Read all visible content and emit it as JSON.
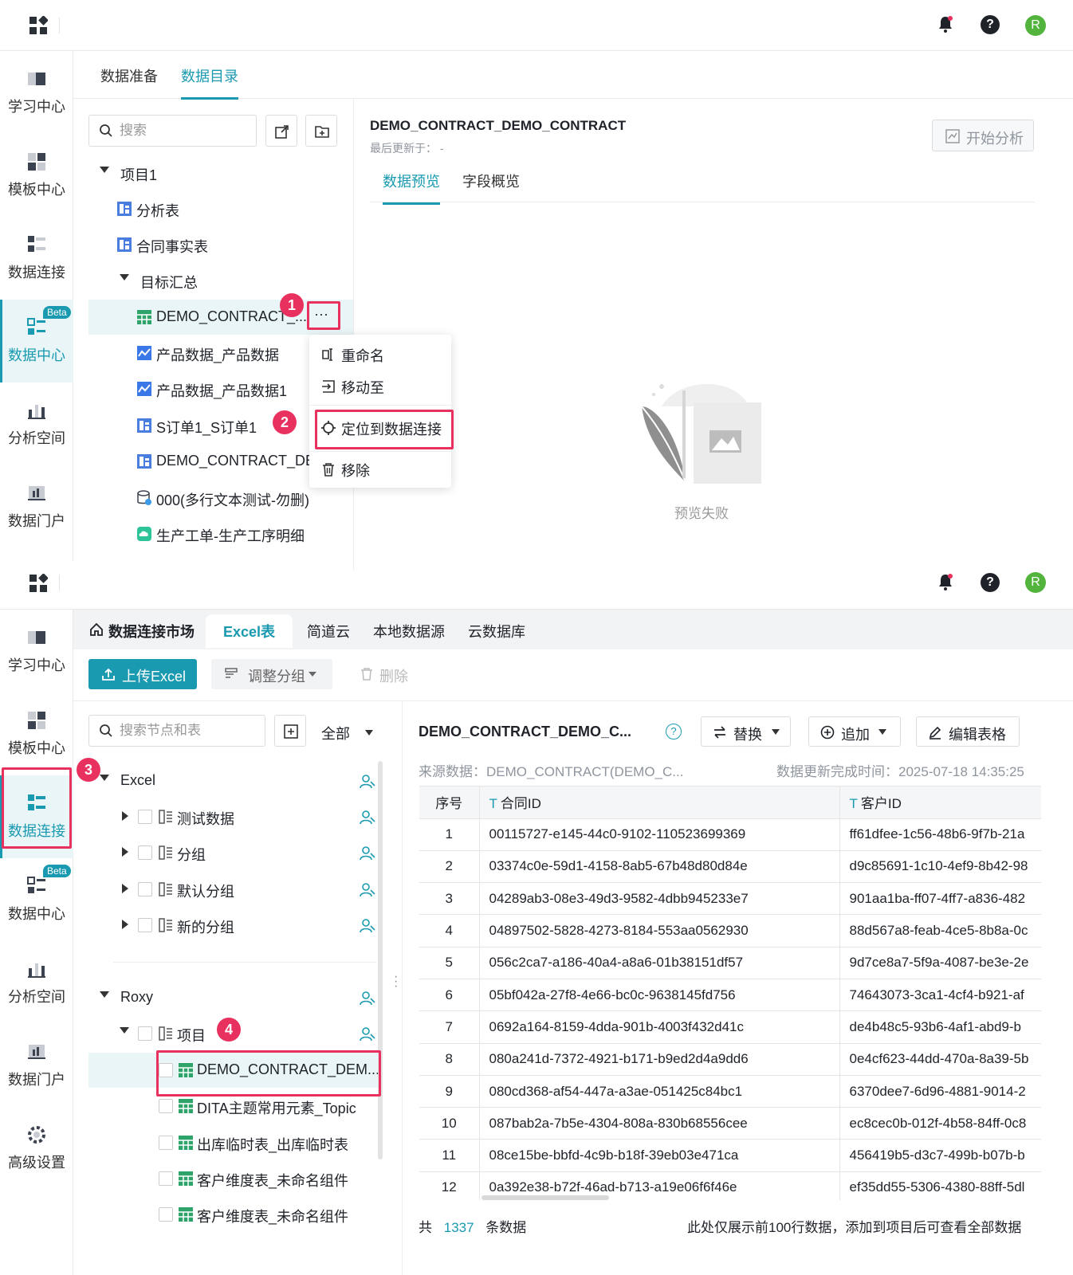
{
  "screen1": {
    "nav": [
      {
        "label": "学习中心",
        "icon": "learning-center-icon"
      },
      {
        "label": "模板中心",
        "icon": "template-center-icon"
      },
      {
        "label": "数据连接",
        "icon": "data-connection-icon"
      },
      {
        "label": "数据中心",
        "icon": "data-center-icon",
        "badge": "Beta",
        "active": true
      },
      {
        "label": "分析空间",
        "icon": "analysis-space-icon"
      },
      {
        "label": "数据门户",
        "icon": "data-portal-icon"
      }
    ],
    "tabs": [
      "数据准备",
      "数据目录"
    ],
    "search_placeholder": "搜索",
    "tree": {
      "project": "项目1",
      "items": [
        "分析表",
        "合同事实表"
      ],
      "group": "目标汇总",
      "group_items": [
        "DEMO_CONTRACT_...",
        "产品数据_产品数据",
        "产品数据_产品数据1",
        "S订单1_S订单1",
        "DEMO_CONTRACT_DEI",
        "000(多行文本测试-勿删)",
        "生产工单-生产工序明细"
      ],
      "more": "···"
    },
    "context_menu": [
      "重命名",
      "移动至",
      "定位到数据连接",
      "移除"
    ],
    "badges": [
      "1",
      "2"
    ],
    "detail": {
      "title": "DEMO_CONTRACT_DEMO_CONTRACT",
      "updated_label": "最后更新于：",
      "updated_value": "-",
      "start_btn": "开始分析",
      "tabs": [
        "数据预览",
        "字段概览"
      ],
      "empty_text": "预览失败"
    }
  },
  "screen2": {
    "nav": [
      {
        "label": "学习中心",
        "icon": "learning-center-icon"
      },
      {
        "label": "模板中心",
        "icon": "template-center-icon"
      },
      {
        "label": "数据连接",
        "icon": "data-connection-icon",
        "active": true
      },
      {
        "label": "数据中心",
        "icon": "data-center-icon",
        "badge": "Beta"
      },
      {
        "label": "分析空间",
        "icon": "analysis-space-icon"
      },
      {
        "label": "数据门户",
        "icon": "data-portal-icon"
      },
      {
        "label": "高级设置",
        "icon": "settings-icon"
      }
    ],
    "tabs": [
      "数据连接市场",
      "Excel表",
      "简道云",
      "本地数据源",
      "云数据库"
    ],
    "toolbar": {
      "upload": "上传Excel",
      "regroup": "调整分组",
      "delete": "删除"
    },
    "search_placeholder": "搜索节点和表",
    "filter": "全部",
    "tree": {
      "excel": "Excel",
      "excel_groups": [
        "测试数据",
        "分组",
        "默认分组",
        "新的分组"
      ],
      "roxy": "Roxy",
      "roxy_group": "项目",
      "tables": [
        "DEMO_CONTRACT_DEM...",
        "DITA主题常用元素_Topic",
        "出库临时表_出库临时表",
        "客户维度表_未命名组件",
        "客户维度表_未命名组件"
      ]
    },
    "badges": [
      "3",
      "4"
    ],
    "detail": {
      "title": "DEMO_CONTRACT_DEMO_C...",
      "replace_btn": "替换",
      "append_btn": "追加",
      "edit_btn": "编辑表格",
      "source_label": "来源数据：",
      "source_value": "DEMO_CONTRACT(DEMO_C...",
      "updated_label": "数据更新完成时间：",
      "updated_value": "2025-07-18 14:35:25",
      "columns": [
        "序号",
        "合同ID",
        "客户ID"
      ],
      "rows": [
        [
          "1",
          "00115727-e145-44c0-9102-110523699369",
          "ff61dfee-1c56-48b6-9f7b-21a"
        ],
        [
          "2",
          "03374c0e-59d1-4158-8ab5-67b48d80d84e",
          "d9c85691-1c10-4ef9-8b42-98"
        ],
        [
          "3",
          "04289ab3-08e3-49d3-9582-4dbb945233e7",
          "901aa1ba-ff07-4ff7-a836-482"
        ],
        [
          "4",
          "04897502-5828-4273-8184-553aa0562930",
          "88d567a8-feab-4ce5-8b8a-0c"
        ],
        [
          "5",
          "056c2ca7-a186-40a4-a8a6-01b38151df57",
          "9d7ce8a7-5f9a-4087-be3e-2e"
        ],
        [
          "6",
          "05bf042a-27f8-4e66-bc0c-9638145fd756",
          "74643073-3ca1-4cf4-b921-af"
        ],
        [
          "7",
          "0692a164-8159-4dda-901b-4003f432d41c",
          "de4b48c5-93b6-4af1-abd9-b"
        ],
        [
          "8",
          "080a241d-7372-4921-b171-b9ed2d4a9dd6",
          "0e4cf623-44dd-470a-8a39-5b"
        ],
        [
          "9",
          "080cd368-af54-447a-a3ae-051425c84bc1",
          "6370dee7-6d96-4881-9014-2"
        ],
        [
          "10",
          "087bab2a-7b5e-4304-808a-830b68556cee",
          "ec8cec0b-012f-4b58-84ff-0c8"
        ],
        [
          "11",
          "08ce15be-bbfd-4c9b-b18f-39eb03e471ca",
          "456419b5-d3c7-499b-b07b-b"
        ],
        [
          "12",
          "0a392e38-b72f-46ad-b713-a19e06f6f46e",
          "ef35dd55-5306-4380-88ff-5dl"
        ]
      ],
      "footer_prefix": "共",
      "footer_count": "1337",
      "footer_suffix": "条数据",
      "footer_note": "此处仅展示前100行数据，添加到项目后可查看全部数据"
    }
  },
  "avatar_letter": "R",
  "help_symbol": "?",
  "colors": {
    "accent": "#1a9ab0",
    "highlight": "#e8315f",
    "avatar": "#52b43c"
  }
}
